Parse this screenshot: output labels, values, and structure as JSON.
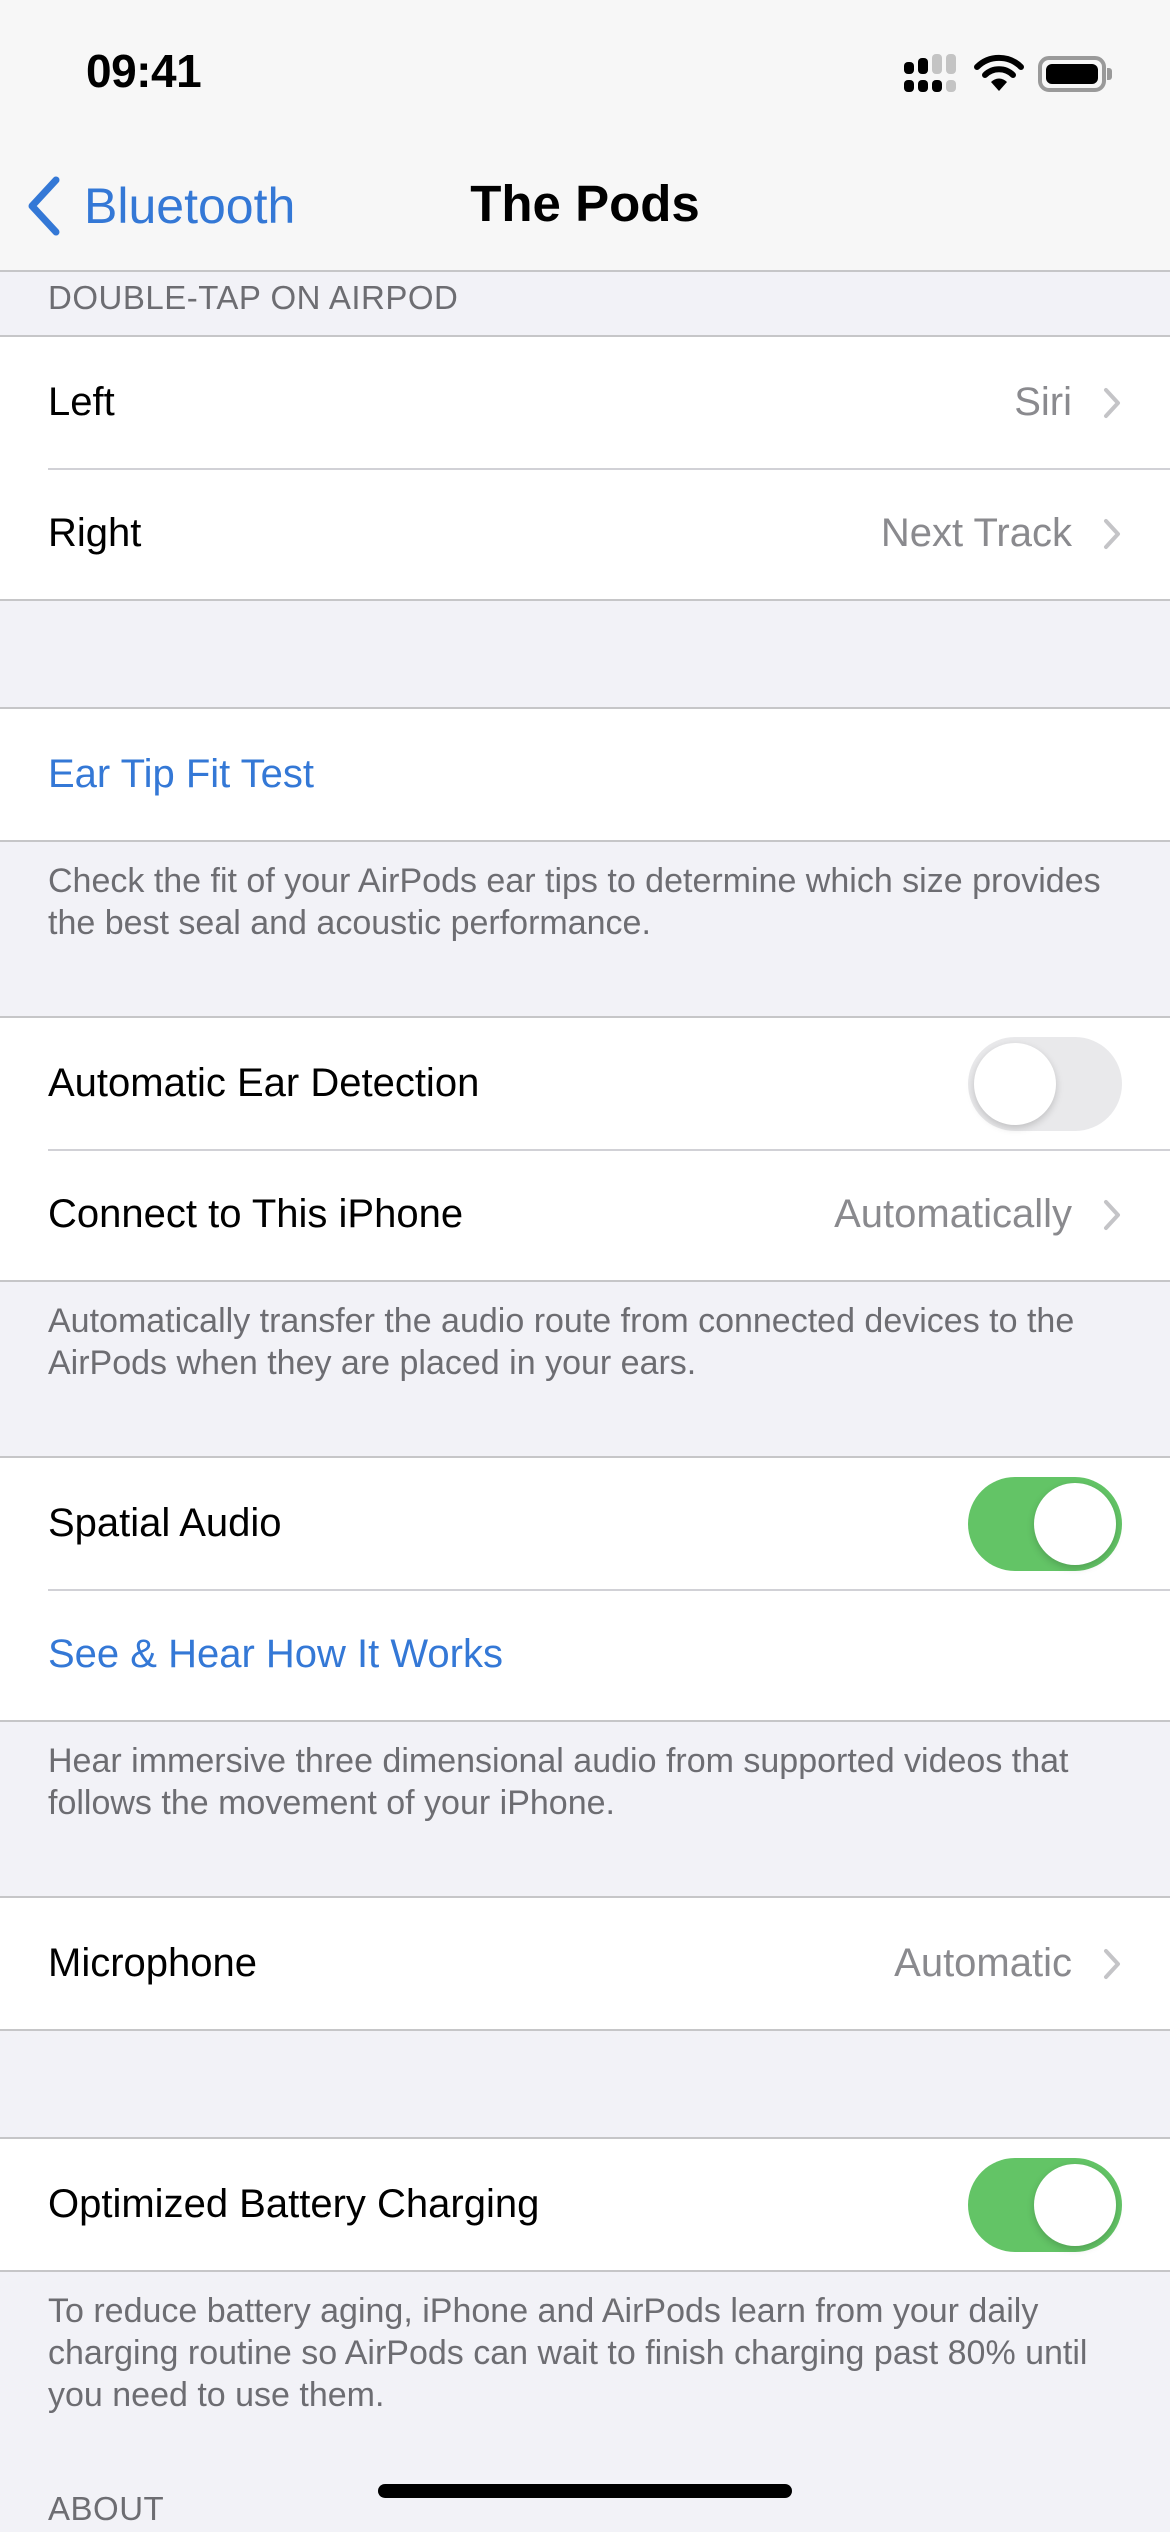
{
  "status_bar": {
    "time": "09:41",
    "icons": [
      "dual-sim-signal-icon",
      "wifi-icon",
      "battery-icon"
    ]
  },
  "nav": {
    "back_label": "Bluetooth",
    "back_icon": "chevron-left-icon",
    "title": "The Pods"
  },
  "double_tap": {
    "header": "DOUBLE-TAP ON AIRPOD",
    "rows": [
      {
        "title": "Left",
        "value": "Siri"
      },
      {
        "title": "Right",
        "value": "Next Track"
      }
    ]
  },
  "ear_tip": {
    "link": "Ear Tip Fit Test",
    "footer": "Check the fit of your AirPods ear tips to determine which size provides the best seal and acoustic performance."
  },
  "detection": {
    "auto_ear_detection": {
      "title": "Automatic Ear Detection",
      "on": false
    },
    "connect": {
      "title": "Connect to This iPhone",
      "value": "Automatically"
    },
    "footer": "Automatically transfer the audio route from connected devices to the AirPods when they are placed in your ears."
  },
  "spatial": {
    "spatial_audio": {
      "title": "Spatial Audio",
      "on": true
    },
    "link": "See & Hear How It Works",
    "footer": "Hear immersive three dimensional audio from supported videos that follows the movement of your iPhone."
  },
  "microphone": {
    "title": "Microphone",
    "value": "Automatic"
  },
  "battery": {
    "optimized": {
      "title": "Optimized Battery Charging",
      "on": true
    },
    "footer": "To reduce battery aging, iPhone and AirPods learn from your daily charging routine so AirPods can wait to finish charging past 80% until you need to use them."
  },
  "about_header": "ABOUT",
  "colors": {
    "accent_blue": "#3478d6",
    "toggle_on_green": "#63c466",
    "toggle_off": "#e9e9eb",
    "background": "#f2f2f7",
    "secondary_text": "#6d6d72"
  }
}
